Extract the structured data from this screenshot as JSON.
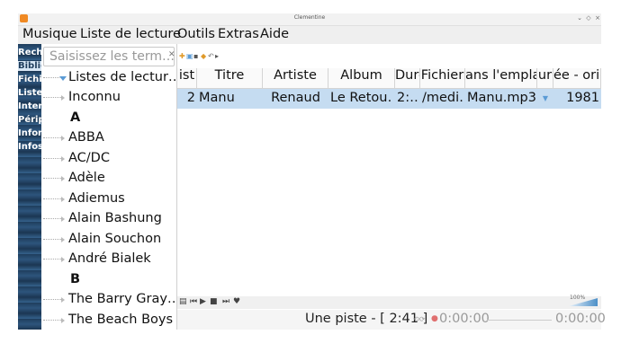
{
  "window": {
    "title": "Clementine",
    "minimize": "⌄",
    "maximize": "◇",
    "close": "×"
  },
  "menu": [
    "Musique",
    "Liste de lecture",
    "Outils",
    "Extras",
    "Aide"
  ],
  "left_tabs": [
    "Rechercher",
    "Bibliothèque",
    "Fichiers",
    "Listes de lecture",
    "Internet",
    "Périphériques",
    "Informations",
    "Infos sur l'artiste"
  ],
  "search": {
    "placeholder": "Saisissez les term…"
  },
  "library": {
    "top_item": "Listes de lectur…",
    "rows": [
      {
        "type": "item",
        "label": "Inconnu"
      },
      {
        "type": "header",
        "label": "A"
      },
      {
        "type": "item",
        "label": "ABBA"
      },
      {
        "type": "item",
        "label": "AC/DC"
      },
      {
        "type": "item",
        "label": "Adèle"
      },
      {
        "type": "item",
        "label": "Adiemus"
      },
      {
        "type": "item",
        "label": "Alain Bashung"
      },
      {
        "type": "item",
        "label": "Alain Souchon"
      },
      {
        "type": "item",
        "label": "André Bialek"
      },
      {
        "type": "header",
        "label": "B"
      },
      {
        "type": "item",
        "label": "The Barry Gray…"
      },
      {
        "type": "item",
        "label": "The Beach Boys"
      }
    ]
  },
  "playlist": {
    "columns": [
      "ist",
      "Titre",
      "Artiste",
      "Album",
      "Duré",
      "Fichier",
      "ans l'empla",
      "ur",
      "ée - orig"
    ],
    "rows": [
      {
        "track": "2",
        "title": "Manu",
        "artist": "Renaud",
        "album": "Le Retou…",
        "duration": "2:…",
        "file": "/medi…",
        "filename": "Manu.mp3",
        "year": "1981"
      }
    ]
  },
  "volume": "100%",
  "status": {
    "summary": "Une piste - [ 2:41 ]",
    "elapsed": "0:00:00",
    "remaining": "0:00:00"
  },
  "colors": {
    "selection": "#c5dcf1",
    "tab_strip": "#2d557c",
    "accent": "#f08a24"
  }
}
